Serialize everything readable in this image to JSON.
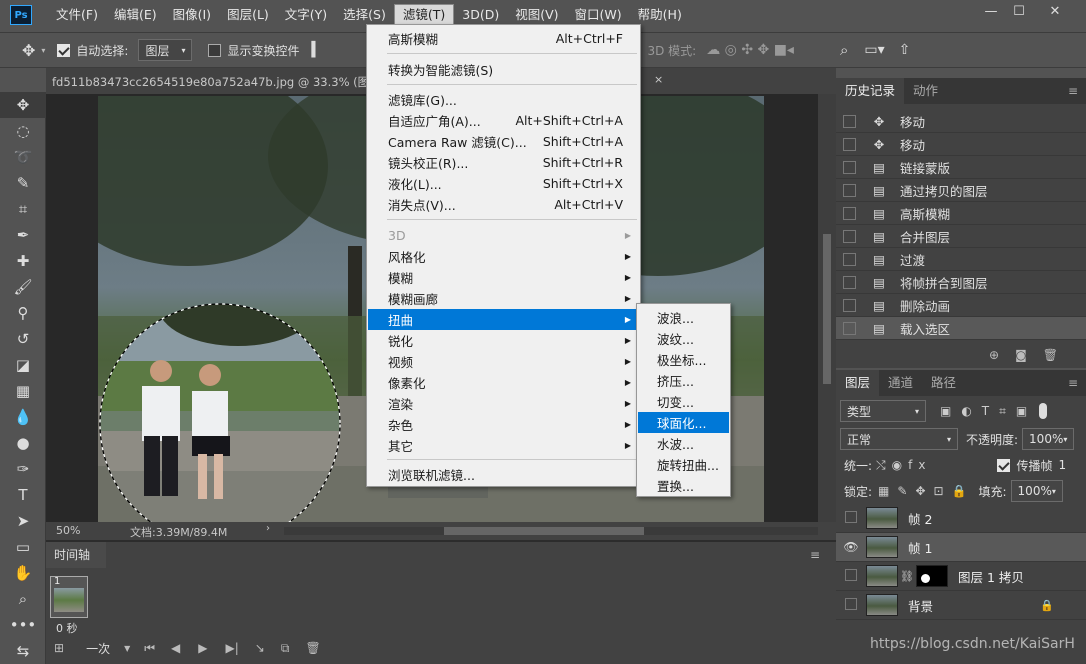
{
  "app": {
    "logo": "Ps"
  },
  "menubar": {
    "items": [
      "文件(F)",
      "编辑(E)",
      "图像(I)",
      "图层(L)",
      "文字(Y)",
      "选择(S)",
      "滤镜(T)",
      "3D(D)",
      "视图(V)",
      "窗口(W)",
      "帮助(H)"
    ]
  },
  "options": {
    "auto_select_label": "自动选择:",
    "auto_select_value": "图层",
    "show_transform_label": "显示变换控件",
    "mode_3d_label": "3D 模式:"
  },
  "document": {
    "tab_title": "fd511b83473cc2654519e80a752a47b.jpg @ 33.3% (图层",
    "tab_close": "×",
    "zoom": "50%",
    "doc_size": "文档:3.39M/89.4M"
  },
  "filter_menu": {
    "items": [
      {
        "label": "高斯模糊",
        "shortcut": "Alt+Ctrl+F"
      },
      {
        "label": "转换为智能滤镜(S)",
        "shortcut": ""
      },
      {
        "label": "滤镜库(G)...",
        "shortcut": ""
      },
      {
        "label": "自适应广角(A)...",
        "shortcut": "Alt+Shift+Ctrl+A"
      },
      {
        "label": "Camera Raw 滤镜(C)...",
        "shortcut": "Shift+Ctrl+A"
      },
      {
        "label": "镜头校正(R)...",
        "shortcut": "Shift+Ctrl+R"
      },
      {
        "label": "液化(L)...",
        "shortcut": "Shift+Ctrl+X"
      },
      {
        "label": "消失点(V)...",
        "shortcut": "Alt+Ctrl+V"
      },
      {
        "label": "3D",
        "shortcut": ""
      },
      {
        "label": "风格化",
        "shortcut": ""
      },
      {
        "label": "模糊",
        "shortcut": ""
      },
      {
        "label": "模糊画廊",
        "shortcut": ""
      },
      {
        "label": "扭曲",
        "shortcut": ""
      },
      {
        "label": "锐化",
        "shortcut": ""
      },
      {
        "label": "视频",
        "shortcut": ""
      },
      {
        "label": "像素化",
        "shortcut": ""
      },
      {
        "label": "渲染",
        "shortcut": ""
      },
      {
        "label": "杂色",
        "shortcut": ""
      },
      {
        "label": "其它",
        "shortcut": ""
      },
      {
        "label": "浏览联机滤镜...",
        "shortcut": ""
      }
    ]
  },
  "distort_submenu": {
    "items": [
      "波浪...",
      "波纹...",
      "极坐标...",
      "挤压...",
      "切变...",
      "球面化...",
      "水波...",
      "旋转扭曲...",
      "置换..."
    ]
  },
  "history_panel": {
    "tabs": [
      "历史记录",
      "动作"
    ],
    "items": [
      "移动",
      "移动",
      "链接蒙版",
      "通过拷贝的图层",
      "高斯模糊",
      "合并图层",
      "过渡",
      "将帧拼合到图层",
      "删除动画",
      "载入选区"
    ]
  },
  "layers_panel": {
    "tabs": [
      "图层",
      "通道",
      "路径"
    ],
    "filter_kind": "类型",
    "blend_mode": "正常",
    "opacity_label": "不透明度:",
    "opacity_value": "100%",
    "unify_label": "统一:",
    "propagate_label": "传播帧",
    "propagate_value": "1",
    "lock_label": "锁定:",
    "fill_label": "填充:",
    "fill_value": "100%",
    "layers": [
      "帧 2",
      "帧 1",
      "图层 1 拷贝",
      "背景"
    ]
  },
  "timeline": {
    "title": "时间轴",
    "frame_number": "1",
    "frame_delay": "0 秒",
    "loop": "一次"
  },
  "watermark": "https://blog.csdn.net/KaiSarH"
}
